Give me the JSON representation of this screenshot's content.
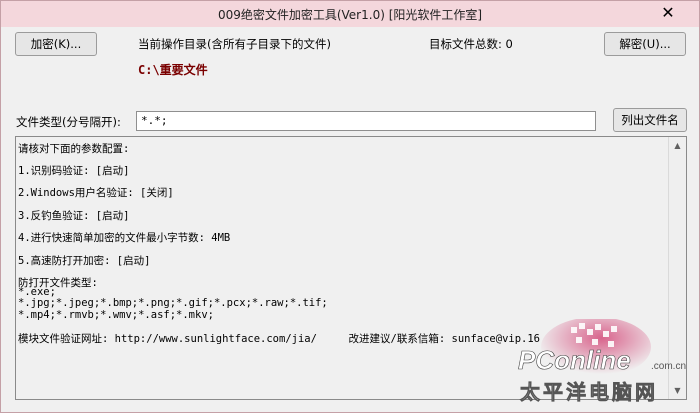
{
  "window": {
    "title": "009绝密文件加密工具(Ver1.0) [阳光软件工作室]",
    "close_glyph": "✕"
  },
  "toolbar": {
    "encrypt_label": "加密(K)...",
    "decrypt_label": "解密(U)...",
    "current_dir_label": "当前操作目录(含所有子目录下的文件)",
    "current_dir_value": "C:\\重要文件",
    "target_count_label": "目标文件总数: 0"
  },
  "filetype": {
    "label": "文件类型(分号隔开):",
    "value": "*.*;",
    "list_button_label": "列出文件名"
  },
  "config_text": {
    "lines": [
      "请核对下面的参数配置:",
      "1.识别码验证: [启动]",
      "2.Windows用户名验证: [关闭]",
      "3.反钓鱼验证: [启动]",
      "4.进行快速简单加密的文件最小字节数: 4MB",
      "5.高速防打开加密: [启动]",
      "防打开文件类型:",
      "*.exe;",
      "*.jpg;*.jpeg;*.bmp;*.png;*.gif;*.pcx;*.raw;*.tif;",
      "*.mp4;*.rmvb;*.wmv;*.asf;*.mkv;",
      "模块文件验证网址: http://www.sunlightface.com/jia/     改进建议/联系信箱: sunface@vip.16"
    ]
  },
  "watermark": {
    "brand": "PConline",
    "domain": ".com.cn",
    "chinese": "太平洋电脑网"
  },
  "colors": {
    "titlebar": "#f4d7dc",
    "directory": "#7a0000",
    "window_bg": "#f0f0f0"
  }
}
